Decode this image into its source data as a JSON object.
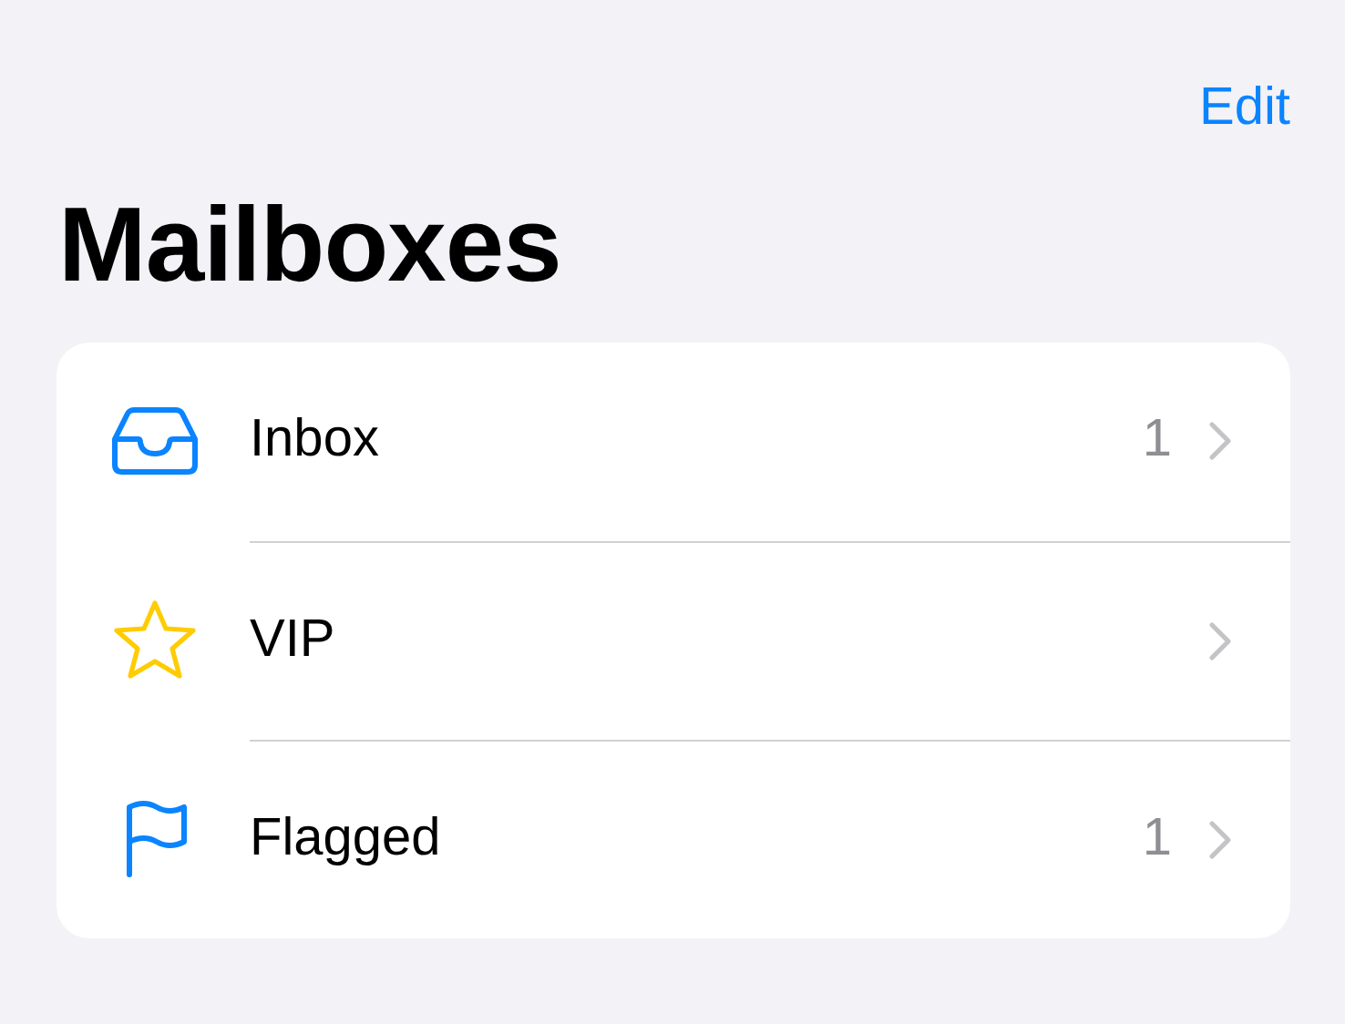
{
  "nav": {
    "edit_button": "Edit"
  },
  "title": "Mailboxes",
  "mailboxes": [
    {
      "kind": "inbox",
      "label": "Inbox",
      "count": "1"
    },
    {
      "kind": "star",
      "label": "VIP"
    },
    {
      "kind": "flag",
      "label": "Flagged",
      "count": "1"
    }
  ]
}
